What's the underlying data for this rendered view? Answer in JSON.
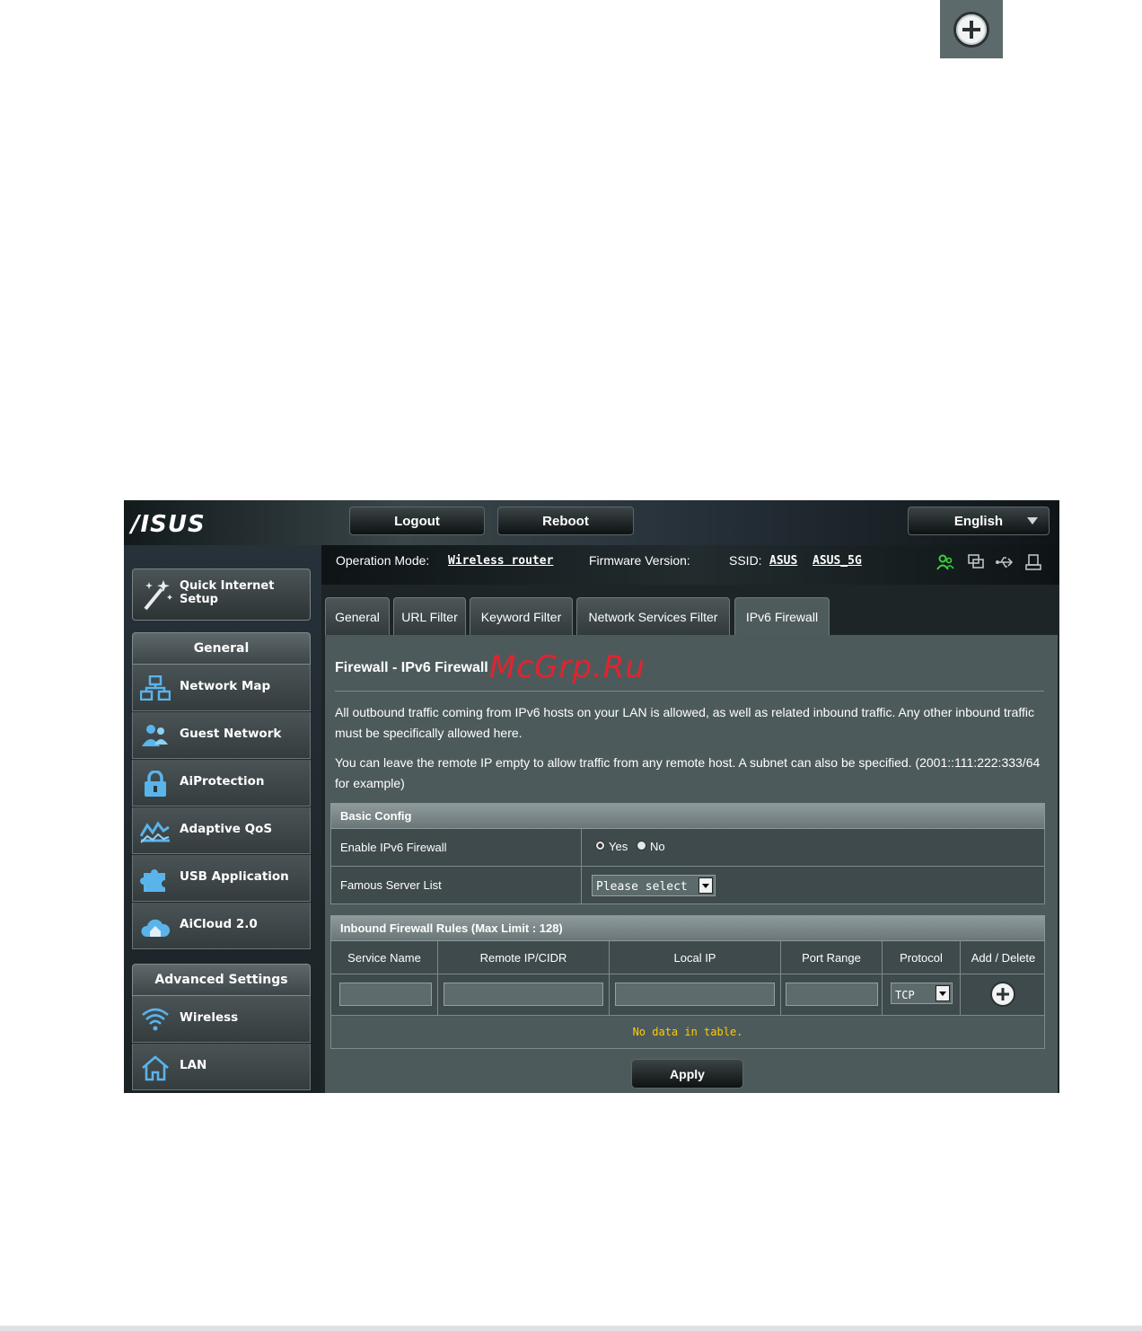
{
  "header": {
    "logo": "/ISUS",
    "logout_label": "Logout",
    "reboot_label": "Reboot",
    "language": "English"
  },
  "status": {
    "op_mode_label": "Operation Mode:",
    "op_mode_value": "Wireless router",
    "firmware_label": "Firmware Version:",
    "ssid_label": "SSID:",
    "ssid_1": "ASUS",
    "ssid_2": "ASUS_5G"
  },
  "sidebar": {
    "qis_label": "Quick Internet Setup",
    "general_title": "General",
    "general_items": [
      {
        "label": "Network Map",
        "icon": "network-map-icon"
      },
      {
        "label": "Guest Network",
        "icon": "guest-network-icon"
      },
      {
        "label": "AiProtection",
        "icon": "lock-icon"
      },
      {
        "label": "Adaptive QoS",
        "icon": "qos-chart-icon"
      },
      {
        "label": "USB Application",
        "icon": "puzzle-icon"
      },
      {
        "label": "AiCloud 2.0",
        "icon": "cloud-icon"
      }
    ],
    "advanced_title": "Advanced Settings",
    "advanced_items": [
      {
        "label": "Wireless",
        "icon": "wifi-icon"
      },
      {
        "label": "LAN",
        "icon": "home-icon"
      }
    ]
  },
  "tabs": [
    {
      "label": "General"
    },
    {
      "label": "URL Filter"
    },
    {
      "label": "Keyword Filter"
    },
    {
      "label": "Network Services Filter"
    },
    {
      "label": "IPv6 Firewall"
    }
  ],
  "active_tab": "IPv6 Firewall",
  "main": {
    "title": "Firewall - IPv6 Firewall",
    "watermark": "McGrp.Ru",
    "desc1": "All outbound traffic coming from IPv6 hosts on your LAN is allowed, as well as related inbound traffic. Any other inbound traffic must be specifically allowed here.",
    "desc2": "You can leave the remote IP empty to allow traffic from any remote host. A subnet can also be specified. (2001::111:222:333/64 for example)",
    "basic_config_title": "Basic Config",
    "enable_label": "Enable IPv6 Firewall",
    "yes_label": "Yes",
    "no_label": "No",
    "enable_value": "Yes",
    "famous_label": "Famous Server List",
    "famous_value": "Please select",
    "rules_title": "Inbound Firewall Rules (Max Limit : 128)",
    "columns": [
      "Service Name",
      "Remote IP/CIDR",
      "Local IP",
      "Port Range",
      "Protocol",
      "Add / Delete"
    ],
    "protocol_value": "TCP",
    "no_data": "No data in table.",
    "apply_label": "Apply"
  }
}
